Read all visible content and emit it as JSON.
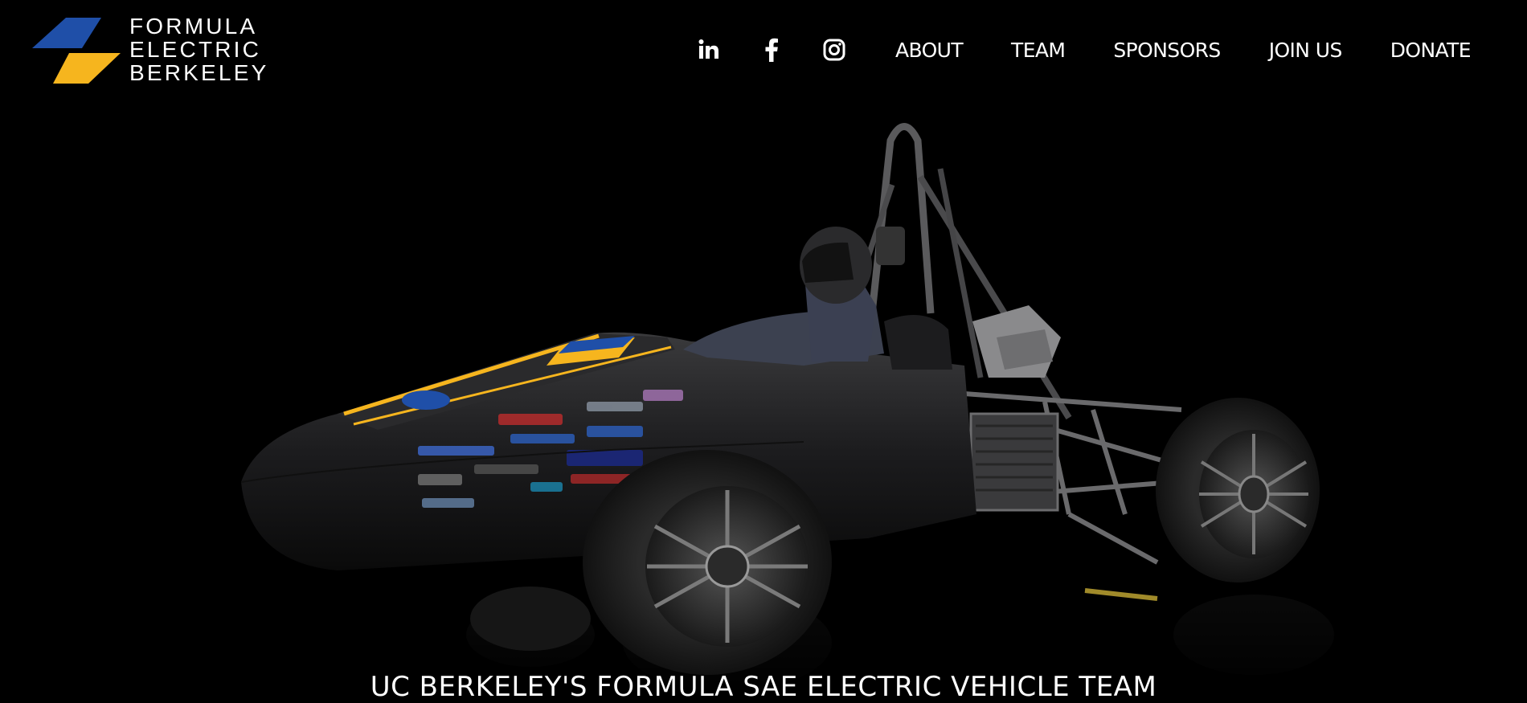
{
  "brand": {
    "lines": [
      "FORMULA",
      "ELECTRIC",
      "BERKELEY"
    ],
    "colors": {
      "blue": "#1f4fa8",
      "gold": "#f6b51e"
    }
  },
  "nav": {
    "social": [
      {
        "name": "linkedin-icon"
      },
      {
        "name": "facebook-icon"
      },
      {
        "name": "instagram-icon"
      }
    ],
    "links": [
      "ABOUT",
      "TEAM",
      "SPONSORS",
      "JOIN US",
      "DONATE"
    ]
  },
  "hero": {
    "tagline": "UC BERKELEY'S FORMULA SAE ELECTRIC VEHICLE TEAM"
  }
}
